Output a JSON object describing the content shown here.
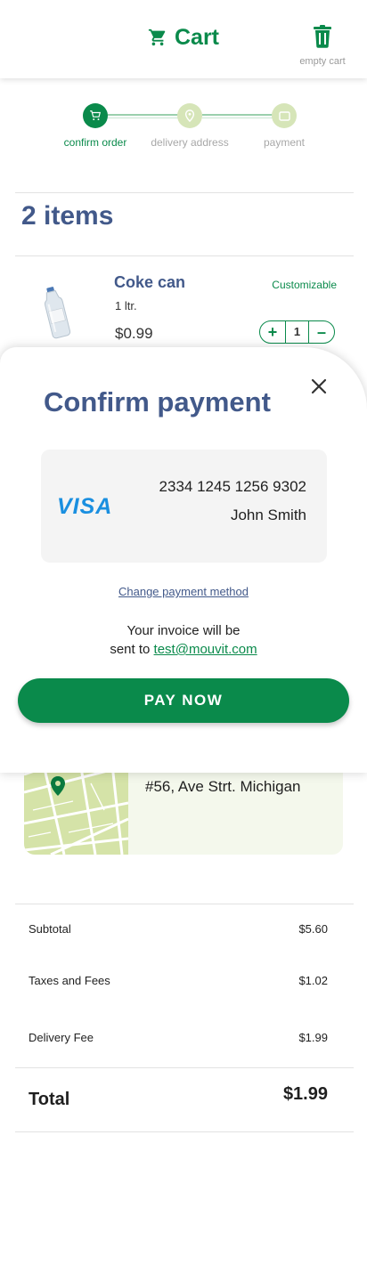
{
  "header": {
    "title": "Cart",
    "empty_cart_label": "empty cart",
    "cart_icon": "cart-icon",
    "trash_icon": "trash-icon"
  },
  "steps": [
    {
      "label": "confirm order",
      "state": "active",
      "icon": "cart-icon"
    },
    {
      "label": "delivery address",
      "state": "inactive",
      "icon": "location-pin-icon"
    },
    {
      "label": "payment",
      "state": "inactive",
      "icon": "card-icon"
    }
  ],
  "cart": {
    "items_count_label": "2 items"
  },
  "product": {
    "name": "Coke can",
    "size": "1 ltr.",
    "price": "$0.99",
    "badge": "Customizable",
    "quantity": "1",
    "plus": "+",
    "minus": "–"
  },
  "address": {
    "text": "#56, Ave Strt. Michigan"
  },
  "totals": {
    "subtotal_label": "Subtotal",
    "subtotal_value": "$5.60",
    "taxes_label": "Taxes and Fees",
    "taxes_value": "$1.02",
    "delivery_label": "Delivery Fee",
    "delivery_value": "$1.99",
    "total_label": "Total",
    "total_value": "$1.99"
  },
  "modal": {
    "title": "Confirm payment",
    "card_brand": "VISA",
    "card_number": "2334 1245 1256 9302",
    "card_holder": "John Smith",
    "change_link": "Change payment method",
    "invoice_line1": "Your invoice will be",
    "invoice_line2_prefix": "sent to",
    "invoice_email": "test@mouvit.com",
    "pay_button": "PAY NOW"
  },
  "colors": {
    "primary_green": "#0a8a4b",
    "heading_blue": "#42598a",
    "inactive_step": "#d6e5b8",
    "visa_blue": "#1a8fe0"
  }
}
